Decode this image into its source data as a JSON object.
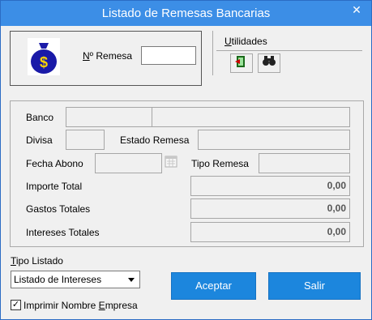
{
  "window": {
    "title": "Listado de Remesas Bancarias",
    "close_glyph": "✕"
  },
  "header": {
    "remesa_label": "Nº Remesa",
    "remesa_value": "",
    "utilidades_label": "Utilidades",
    "icon_money_bag": "money-bag",
    "icon_exit": "exit-door",
    "icon_search": "binoculars"
  },
  "details": {
    "banco_label": "Banco",
    "banco_code": "",
    "banco_name": "",
    "divisa_label": "Divisa",
    "divisa_value": "",
    "estado_label": "Estado Remesa",
    "estado_value": "",
    "fecha_label": "Fecha Abono",
    "fecha_value": "",
    "tipo_label": "Tipo Remesa",
    "tipo_value": "",
    "importe_label": "Importe Total",
    "importe_value": "0,00",
    "gastos_label": "Gastos Totales",
    "gastos_value": "0,00",
    "intereses_label": "Intereses Totales",
    "intereses_value": "0,00"
  },
  "footer": {
    "tipo_listado_label": "Tipo Listado",
    "tipo_listado_selected": "Listado de Intereses",
    "imprimir_label": "Imprimir Nombre Empresa",
    "imprimir_checked": true,
    "aceptar_label": "Aceptar",
    "salir_label": "Salir"
  },
  "colors": {
    "title_bar": "#3c8ee6",
    "button_blue": "#1c86dd",
    "icon_blue": "#1a1aa8"
  }
}
